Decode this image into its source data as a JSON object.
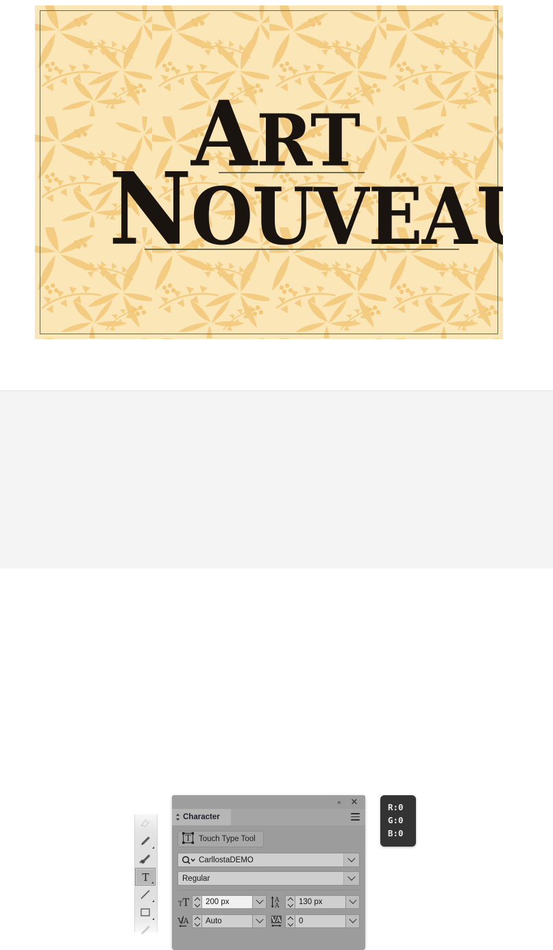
{
  "artwork": {
    "line1": "ART",
    "line1_cap": "A",
    "line1_rest": "RT",
    "line2": "NOUVEAU",
    "line2_cap": "N",
    "line2_rest": "OUVEAU",
    "background_color": "#fbe6b7",
    "pattern_color": "#f4ce84",
    "text_color": "#1a1410",
    "border_color": "#6b6a4a"
  },
  "toolbar": {
    "tools": [
      {
        "name": "pen-anchor-tool",
        "label": "Add Anchor Point Tool"
      },
      {
        "name": "pencil-tool",
        "label": "Pencil Tool"
      },
      {
        "name": "blob-brush-tool",
        "label": "Blob Brush Tool"
      },
      {
        "name": "type-tool",
        "label": "Type Tool"
      },
      {
        "name": "line-segment-tool",
        "label": "Line Segment Tool"
      },
      {
        "name": "rectangle-tool",
        "label": "Rectangle Tool"
      },
      {
        "name": "paintbrush-tool",
        "label": "Paintbrush Tool"
      }
    ],
    "selected_tool": "type-tool"
  },
  "character_panel": {
    "title": "Character",
    "collapse_icon": "«",
    "close_icon": "✕",
    "menu_icon": "hamburger-icon",
    "touch_type_label": "Touch Type Tool",
    "font_family": "CarllostaDEMO",
    "font_style": "Regular",
    "font_size": "200 px",
    "leading": "130 px",
    "kerning": "Auto",
    "tracking": "0",
    "labels": {
      "font_size": "Font Size",
      "leading": "Leading",
      "kerning": "Kerning",
      "tracking": "Tracking"
    }
  },
  "rgb_readout": {
    "r": "R:0",
    "g": "G:0",
    "b": "B:0",
    "background": "#333333"
  }
}
